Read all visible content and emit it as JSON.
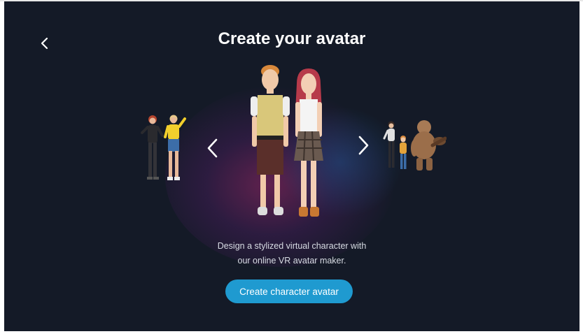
{
  "header": {
    "title": "Create your avatar",
    "back_icon": "chevron-left-icon"
  },
  "carousel": {
    "prev_icon": "chevron-left-icon",
    "next_icon": "chevron-right-icon",
    "slides": [
      "left-avatar-pair",
      "center-avatar-pair",
      "right-avatar-group"
    ]
  },
  "main": {
    "description_line1": "Design a stylized virtual character with",
    "description_line2": "our online VR avatar maker.",
    "cta_label": "Create character avatar"
  },
  "colors": {
    "background": "#141a27",
    "accent": "#1f9ad0",
    "text": "#ffffff"
  }
}
